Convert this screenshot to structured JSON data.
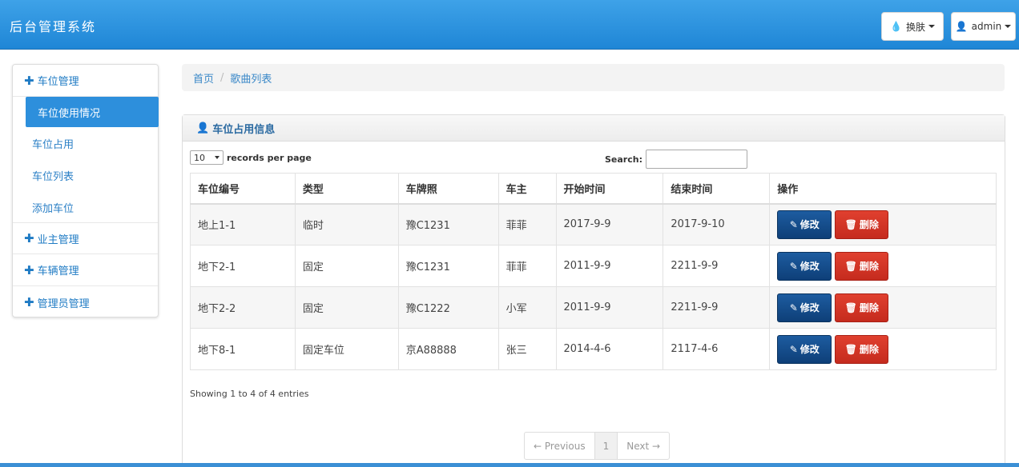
{
  "header": {
    "title": "后台管理系统",
    "skin_label": "换肤",
    "user_label": "admin"
  },
  "sidebar": {
    "groups": [
      {
        "label": "车位管理"
      },
      {
        "label": "业主管理"
      },
      {
        "label": "车辆管理"
      },
      {
        "label": "管理员管理"
      }
    ],
    "items": [
      {
        "label": "车位使用情况",
        "active": true
      },
      {
        "label": "车位占用"
      },
      {
        "label": "车位列表"
      },
      {
        "label": "添加车位"
      }
    ]
  },
  "breadcrumb": {
    "home": "首页",
    "sep": "/",
    "current": "歌曲列表"
  },
  "panel": {
    "title": "车位占用信息",
    "page_size": "10",
    "records_label": "records per page",
    "search_label": "Search:",
    "search_value": "",
    "columns": [
      "车位编号",
      "类型",
      "车牌照",
      "车主",
      "开始时间",
      "结束时间",
      "操作"
    ],
    "rows": [
      [
        "地上1-1",
        "临时",
        "豫C1231",
        "菲菲",
        "2017-9-9",
        "2017-9-10"
      ],
      [
        "地下2-1",
        "固定",
        "豫C1231",
        "菲菲",
        "2011-9-9",
        "2211-9-9"
      ],
      [
        "地下2-2",
        "固定",
        "豫C1222",
        "小军",
        "2011-9-9",
        "2211-9-9"
      ],
      [
        "地下8-1",
        "固定车位",
        "京A88888",
        "张三",
        "2014-4-6",
        "2117-4-6"
      ]
    ],
    "edit_label": "修改",
    "delete_label": "删除",
    "info": "Showing 1 to 4 of 4 entries",
    "pager": {
      "prev": "← Previous",
      "page": "1",
      "next": "Next →"
    }
  }
}
